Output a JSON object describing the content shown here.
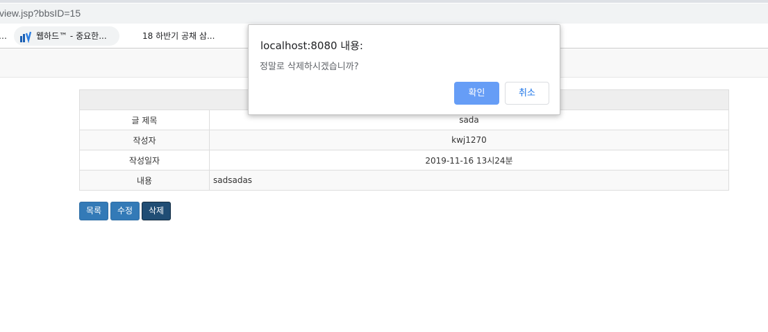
{
  "browser": {
    "url": "view.jsp?bbsID=15",
    "bookmarks": [
      {
        "label": "…"
      },
      {
        "label": "웹하드™ - 중요한..."
      },
      {
        "label": "18 하반기 공채 삼..."
      }
    ]
  },
  "post": {
    "rows": [
      {
        "label": "글 제목",
        "value": "sada"
      },
      {
        "label": "작성자",
        "value": "kwj1270"
      },
      {
        "label": "작성일자",
        "value": "2019-11-16 13시24분"
      },
      {
        "label": "내용",
        "value": "sadsadas"
      }
    ]
  },
  "actions": {
    "list_label": "목록",
    "edit_label": "수정",
    "delete_label": "삭제"
  },
  "dialog": {
    "title": "localhost:8080 내용:",
    "message": "정말로 삭제하시겠습니까?",
    "ok_label": "확인",
    "cancel_label": "취소"
  },
  "colors": {
    "primary_button": "#337ab7",
    "active_button": "#204d74",
    "dialog_ok": "#669df6",
    "dialog_cancel_text": "#1a73e8"
  }
}
